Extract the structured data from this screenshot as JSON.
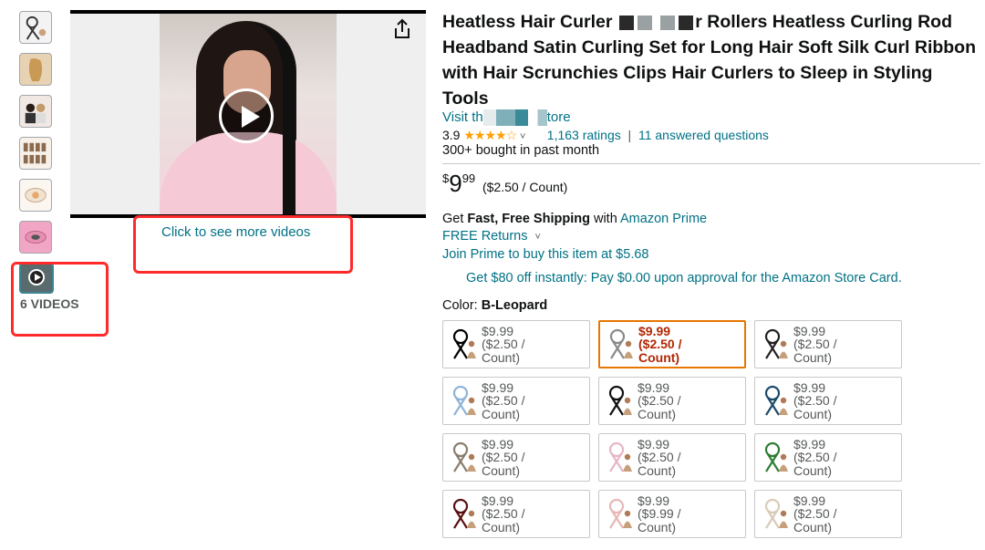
{
  "gallery": {
    "thumbnails": [
      {
        "name": "thumb-product"
      },
      {
        "name": "thumb-hair"
      },
      {
        "name": "thumb-models"
      },
      {
        "name": "thumb-grid"
      },
      {
        "name": "thumb-pack"
      },
      {
        "name": "thumb-scrunchies"
      }
    ],
    "videos_label": "6 VIDEOS",
    "more_videos_link": "Click to see more videos"
  },
  "product": {
    "title_part1": "Heatless Hair Curler",
    "title_part2": "r Rollers Heatless Curling Rod Headband Satin Curling Set for Long Hair Soft Silk Curl Ribbon with Hair Scrunchies Clips Hair Curlers to Sleep in Styling Tools",
    "store_prefix": "Visit th",
    "store_suffix": "tore",
    "rating": "3.9",
    "stars": "★★★★☆",
    "ratings_link": "1,163 ratings",
    "separator": "|",
    "questions_link": "11 answered questions",
    "bought": "300+ bought in past month"
  },
  "price": {
    "currency": "$",
    "whole": "9",
    "fraction": "99",
    "per_unit": "($2.50 / Count)"
  },
  "shipping": {
    "prefix": "Get ",
    "fast": "Fast, Free Shipping",
    "with": " with ",
    "prime_link": "Amazon Prime",
    "returns": "FREE Returns",
    "returns_chevron": "˅",
    "join": "Join Prime to buy this item at $5.68"
  },
  "promo": "Get $80 off instantly: Pay $0.00 upon approval for the Amazon Store Card.",
  "color": {
    "label": "Color: ",
    "value": "B-Leopard"
  },
  "swatches": [
    {
      "l1": "$9.99",
      "l2": "($2.50 /",
      "l3": "Count)",
      "color": "#000000"
    },
    {
      "l1": "$9.99",
      "l2": "($2.50 /",
      "l3": "Count)",
      "color": "#8a8a8a"
    },
    {
      "l1": "$9.99",
      "l2": "($2.50 /",
      "l3": "Count)",
      "color": "#222222"
    },
    {
      "l1": "$9.99",
      "l2": "($2.50 /",
      "l3": "Count)",
      "color": "#8fb4d8"
    },
    {
      "l1": "$9.99",
      "l2": "($2.50 /",
      "l3": "Count)",
      "color": "#111111"
    },
    {
      "l1": "$9.99",
      "l2": "($2.50 /",
      "l3": "Count)",
      "color": "#1d4a6b"
    },
    {
      "l1": "$9.99",
      "l2": "($2.50 /",
      "l3": "Count)",
      "color": "#8a7d6c"
    },
    {
      "l1": "$9.99",
      "l2": "($2.50 /",
      "l3": "Count)",
      "color": "#e6b6c5"
    },
    {
      "l1": "$9.99",
      "l2": "($2.50 /",
      "l3": "Count)",
      "color": "#2e7d32"
    },
    {
      "l1": "$9.99",
      "l2": "($2.50 /",
      "l3": "Count)",
      "color": "#5a1010"
    },
    {
      "l1": "$9.99",
      "l2": "($9.99 /",
      "l3": "Count)",
      "color": "#e8b7b7"
    },
    {
      "l1": "$9.99",
      "l2": "($2.50 /",
      "l3": "Count)",
      "color": "#d9cbb8"
    }
  ],
  "selected_swatch": 1,
  "colors": {
    "link": "#007185",
    "highlight_red": "#ff2b2b",
    "selected_border": "#e77600",
    "selected_price": "#b12704",
    "star": "#ff9f00"
  }
}
